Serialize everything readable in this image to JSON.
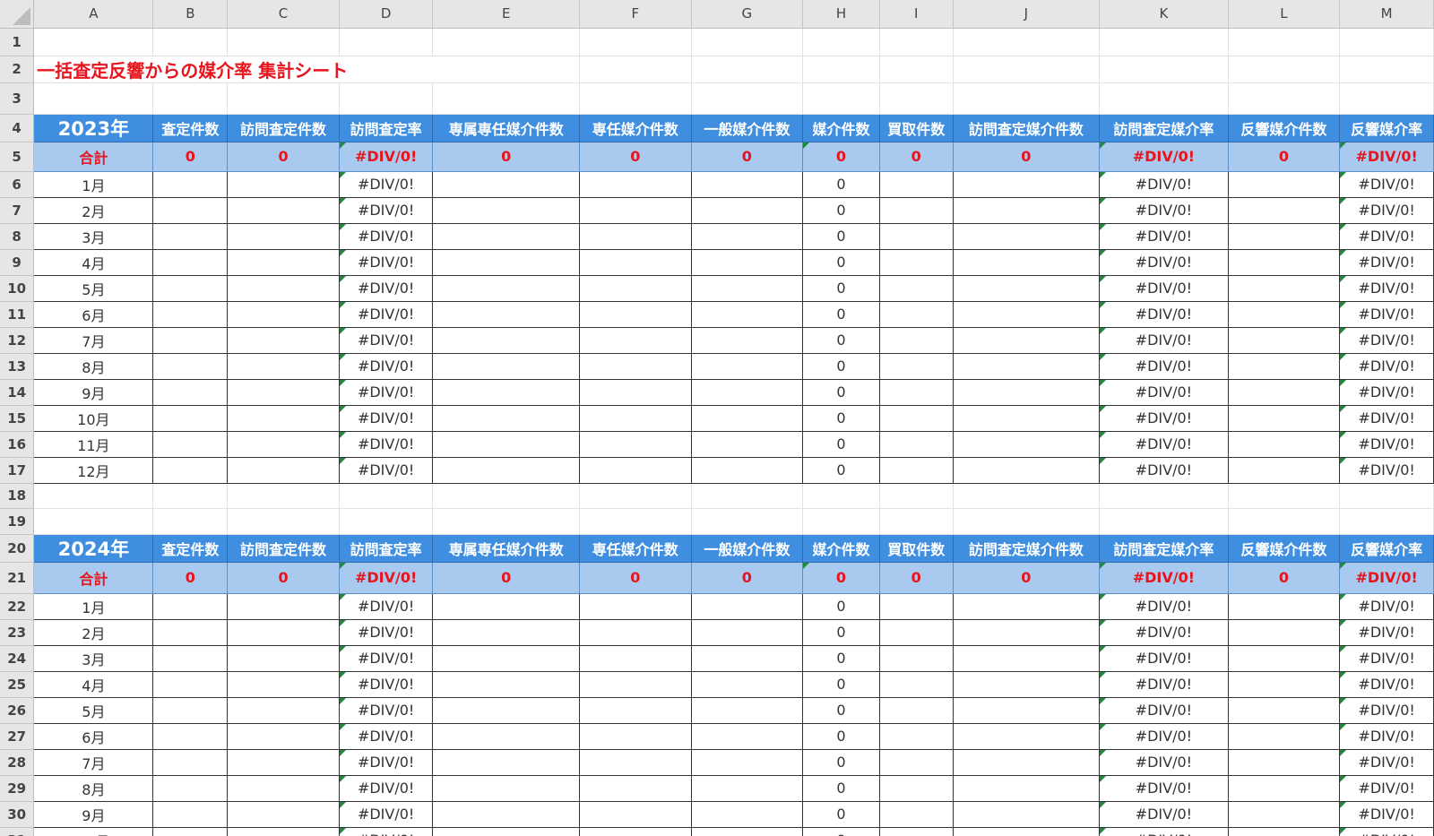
{
  "columns": [
    "A",
    "B",
    "C",
    "D",
    "E",
    "F",
    "G",
    "H",
    "I",
    "J",
    "K",
    "L",
    "M"
  ],
  "title": "一括査定反響からの媒介率 集計シート",
  "headers": [
    "査定件数",
    "訪問査定件数",
    "訪問査定率",
    "専属専任媒介件数",
    "専任媒介件数",
    "一般媒介件数",
    "媒介件数",
    "買取件数",
    "訪問査定媒介件数",
    "訪問査定媒介率",
    "反響媒介件数",
    "反響媒介率"
  ],
  "months": [
    "1月",
    "2月",
    "3月",
    "4月",
    "5月",
    "6月",
    "7月",
    "8月",
    "9月",
    "10月",
    "11月",
    "12月"
  ],
  "blocks": [
    {
      "year": "2023年",
      "total_label": "合計",
      "totals": [
        "0",
        "0",
        "#DIV/0!",
        "0",
        "0",
        "0",
        "0",
        "0",
        "0",
        "#DIV/0!",
        "0",
        "#DIV/0!"
      ]
    },
    {
      "year": "2024年",
      "total_label": "合計",
      "totals": [
        "0",
        "0",
        "#DIV/0!",
        "0",
        "0",
        "0",
        "0",
        "0",
        "0",
        "#DIV/0!",
        "0",
        "#DIV/0!"
      ]
    }
  ],
  "monthly_values": {
    "訪問査定率": "#DIV/0!",
    "媒介件数": "0",
    "訪問査定媒介率": "#DIV/0!",
    "反響媒介率": "#DIV/0!"
  },
  "colors": {
    "header_blue": "#3f8ee0",
    "total_row": "#a9c9ee",
    "error_red": "#e8141d",
    "formula_marker_green": "#1e8a3c"
  }
}
